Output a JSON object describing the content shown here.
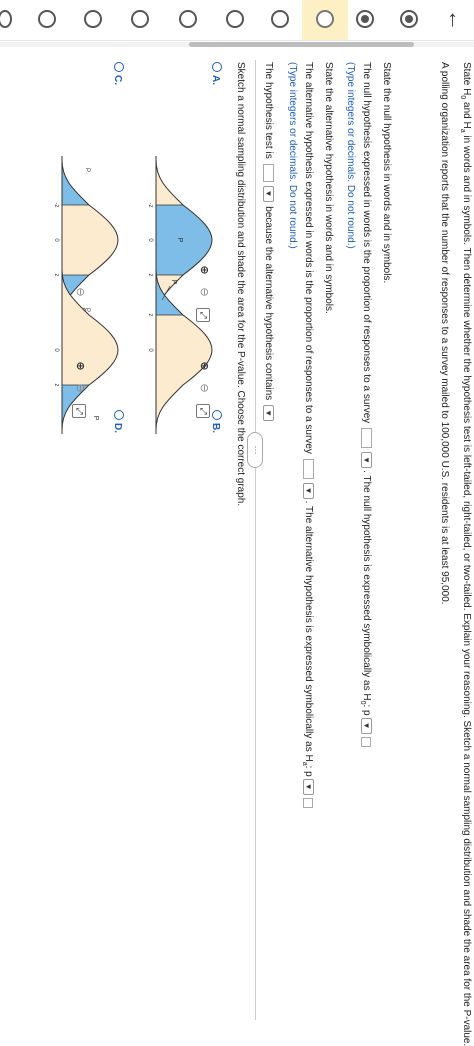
{
  "nav": {
    "back_arrow": "←",
    "items": [
      "done",
      "done",
      "current",
      "todo",
      "todo",
      "todo",
      "todo",
      "todo",
      "todo",
      "todo"
    ]
  },
  "question": {
    "line1_pre": "State H",
    "line1_sub0": "0",
    "line1_mid": " and H",
    "line1_suba": "a",
    "line1_post": " in words and in symbols. Then determine whether the hypothesis test is left-tailed, right-tailed, or two-tailed. Explain your reasoning. Sketch a normal sampling distribution and shade the area for the P-value.",
    "line2": "A polling organization reports that the number of responses to a survey mailed to 100,000 U.S. residents is at least 95,000."
  },
  "more_button": "···",
  "answer": {
    "null_heading": "State the null hypothesis in words and in symbols.",
    "null_words_pre": "The null hypothesis expressed in words is the proportion of responses to a survey",
    "null_words_post": ". The null hypothesis is expressed symbolically as H",
    "null_sym_sub": "0",
    "null_sym_post": ": p",
    "hint1": "(Type integers or decimals. Do not round.)",
    "alt_heading": "State the alternative hypothesis in words and in symbols.",
    "alt_words_pre": "The alternative hypothesis expressed in words is the proportion of responses to a survey",
    "alt_words_post": ". The alternative hypothesis is expressed symbolically as H",
    "alt_sym_sub": "a",
    "alt_sym_post": ": p",
    "hint2": "(Type integers or decimals. Do not round.)",
    "test_pre": "The hypothesis test is",
    "test_mid": "because the alternative hypothesis contains",
    "sketch_prompt": "Sketch a normal sampling distribution and shade the area for the P-value. Choose the correct graph."
  },
  "options": {
    "A": {
      "label": "A.",
      "left": "-z",
      "center": "0",
      "right": "z",
      "p": "P"
    },
    "B": {
      "label": "B.",
      "left": "",
      "center": "0",
      "right": "z",
      "p": "P"
    },
    "C": {
      "label": "C.",
      "left": "-z",
      "center": "0",
      "right": "z",
      "p_left_top": "1",
      "p_left_mid": "—",
      "p_left_bot": "2",
      "p_left_p": "P",
      "p_right_top": "1",
      "p_right_bot": "2",
      "p_right_p": "P"
    },
    "D": {
      "label": "D.",
      "left": "",
      "center": "0",
      "right": "z",
      "p": "P"
    }
  },
  "colors": {
    "accent": "#1f5fb4",
    "curve_fill": "#fdebd0",
    "shade": "#7dbde8",
    "highlight": "#fdf0c4"
  }
}
